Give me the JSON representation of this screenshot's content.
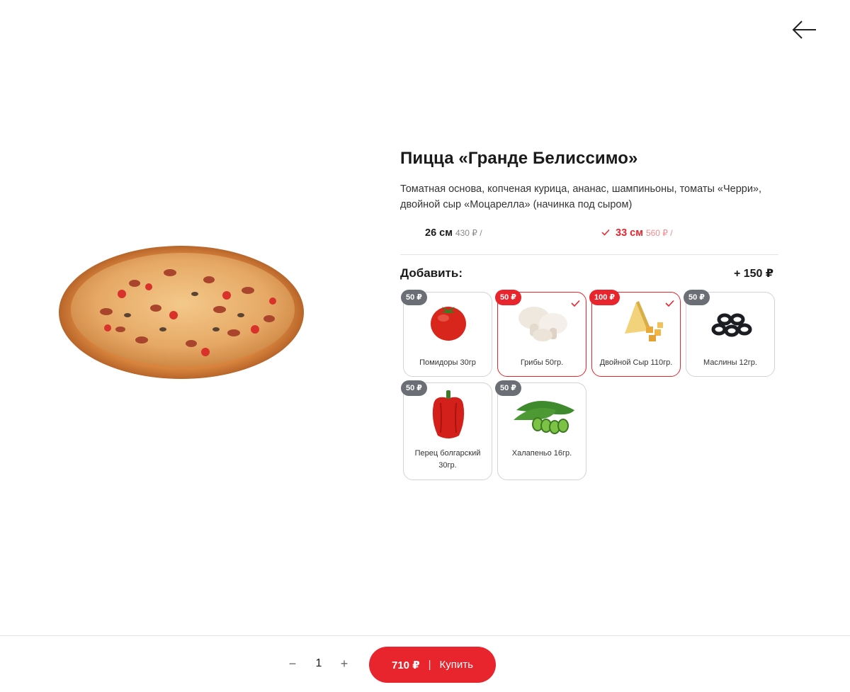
{
  "product": {
    "title": "Пицца «Гранде Белиссимо»",
    "description": "Томатная основа, копченая курица, ананас, шампиньоны, томаты «Черри», двойной сыр «Моцарелла» (начинка под сыром)"
  },
  "sizes": [
    {
      "label": "26 см",
      "price": "430 ₽ /",
      "selected": false
    },
    {
      "label": "33 см",
      "price": "560 ₽ /",
      "selected": true
    }
  ],
  "addons": {
    "title": "Добавить:",
    "total": "+ 150 ₽",
    "items": [
      {
        "price": "50 ₽",
        "name": "Помидоры 30гр",
        "selected": false,
        "icon": "tomato-icon"
      },
      {
        "price": "50 ₽",
        "name": "Грибы 50гр.",
        "selected": true,
        "icon": "mushroom-icon"
      },
      {
        "price": "100 ₽",
        "name": "Двойной Сыр 110гр.",
        "selected": true,
        "icon": "cheese-icon"
      },
      {
        "price": "50 ₽",
        "name": "Маслины 12гр.",
        "selected": false,
        "icon": "olives-icon"
      },
      {
        "price": "50 ₽",
        "name": "Перец болгарский 30гр.",
        "selected": false,
        "icon": "bell-pepper-icon"
      },
      {
        "price": "50 ₽",
        "name": "Халапеньо 16гр.",
        "selected": false,
        "icon": "jalapeno-icon"
      }
    ]
  },
  "cart": {
    "minus": "−",
    "quantity": "1",
    "plus": "+",
    "price": "710 ₽",
    "separator": "|",
    "buy_label": "Купить"
  },
  "colors": {
    "accent": "#e8242c",
    "badge_gray": "#6b6f75",
    "border": "#d3d3d3"
  }
}
